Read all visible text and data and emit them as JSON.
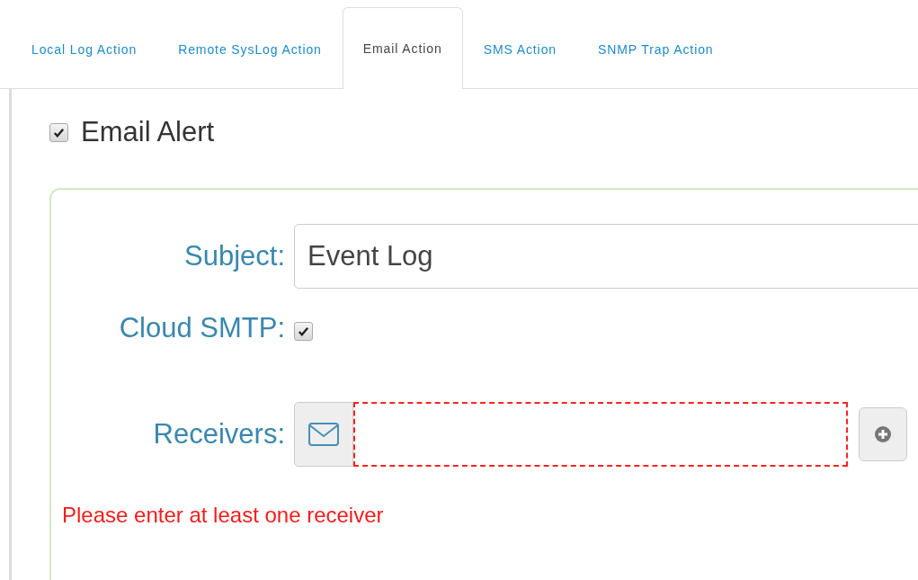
{
  "tabs": [
    {
      "label": "Local Log Action",
      "selected": false
    },
    {
      "label": "Remote SysLog Action",
      "selected": false
    },
    {
      "label": "Email Action",
      "selected": true
    },
    {
      "label": "SMS Action",
      "selected": false
    },
    {
      "label": "SNMP Trap Action",
      "selected": false
    }
  ],
  "email_alert": {
    "label": "Email Alert",
    "checked": true
  },
  "form": {
    "subject": {
      "label": "Subject:",
      "value": "Event Log"
    },
    "cloud_smtp": {
      "label": "Cloud SMTP:",
      "checked": true
    },
    "receivers": {
      "label": "Receivers:",
      "invalid": true
    },
    "error": "Please enter at least one receiver"
  }
}
